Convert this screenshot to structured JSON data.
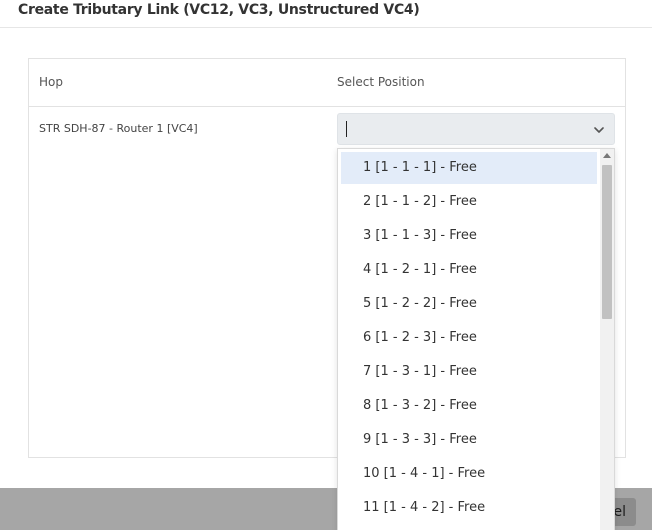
{
  "modal": {
    "title": "Create Tributary Link (VC12, VC3, Unstructured VC4)"
  },
  "table": {
    "headers": {
      "hop": "Hop",
      "position": "Select Position"
    },
    "row": {
      "hop": "STR SDH-87 - Router 1 [VC4]"
    }
  },
  "select": {
    "value": ""
  },
  "dropdown": {
    "options": [
      "1 [1 - 1 - 1] - Free",
      "2 [1 - 1 - 2] - Free",
      "3 [1 - 1 - 3] - Free",
      "4 [1 - 2 - 1] - Free",
      "5 [1 - 2 - 2] - Free",
      "6 [1 - 2 - 3] - Free",
      "7 [1 - 3 - 1] - Free",
      "8 [1 - 3 - 2] - Free",
      "9 [1 - 3 - 3] - Free",
      "10 [1 - 4 - 1] - Free",
      "11 [1 - 4 - 2] - Free"
    ],
    "selected_index": 0,
    "highlight_color": "#e3ecf9"
  },
  "footer": {
    "button_partial_label": "el"
  },
  "icons": {
    "chevron": "chevron-down-icon",
    "scroll_up": "scroll-up-arrow-icon"
  }
}
